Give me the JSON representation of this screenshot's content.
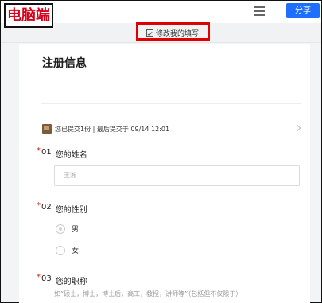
{
  "watermark": "电脑端",
  "header": {
    "share_label": "分享"
  },
  "editbar": {
    "label": "修改我的填写"
  },
  "form": {
    "title": "注册信息",
    "submit_info": "您已提交1份 | 最后提交于 09/14 12:01",
    "questions": [
      {
        "number": "01",
        "required_mark": "*",
        "title": "您的姓名",
        "placeholder": "王瀚"
      },
      {
        "number": "02",
        "required_mark": "*",
        "title": "您的性别",
        "options": [
          "男",
          "女"
        ]
      },
      {
        "number": "03",
        "required_mark": "*",
        "title": "您的职称",
        "description": "如“硕士，博士，博士后，高工，教授，讲师等”（包括但不仅限于）"
      }
    ]
  },
  "icons": {
    "menu": "hamburger-icon",
    "edit": "edit-checkbox-icon",
    "avatar": "user-avatar",
    "chevron": "chevron-right-icon"
  },
  "colors": {
    "accent": "#1e6fff",
    "required": "#d92020",
    "highlight": "#e00000",
    "watermark": "#d9001b"
  }
}
